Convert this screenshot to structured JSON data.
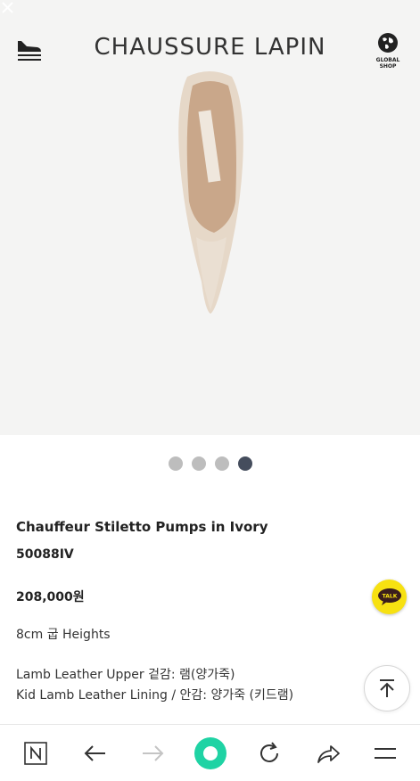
{
  "header": {
    "brand": "CHAUSSURE LAPIN",
    "global_shop": "GLOBAL\nSHOP"
  },
  "carousel": {
    "count": 4,
    "active_index": 3
  },
  "product": {
    "name": "Chauffeur Stiletto Pumps in Ivory",
    "sku": "50088IV",
    "price": "208,000원",
    "height": "8cm 굽 Heights",
    "material_upper": "Lamb Leather Upper 겉감: 램(양가죽)",
    "material_lining": "Kid Lamb Leather Lining / 안감: 양가죽 (키드램)"
  },
  "talk_button": {
    "label": "TALK",
    "color": "#f7e111"
  },
  "colors": {
    "hero_bg": "#f4f4f3",
    "dot_inactive": "#bdbdbd",
    "dot_active": "#454d5d",
    "nav_accent": "#1fd3a4"
  },
  "browser_nav": {
    "icons": [
      "naver-n-icon",
      "back-arrow-icon",
      "forward-arrow-icon",
      "green-dot-icon",
      "refresh-icon",
      "share-icon",
      "menu-icon"
    ]
  }
}
